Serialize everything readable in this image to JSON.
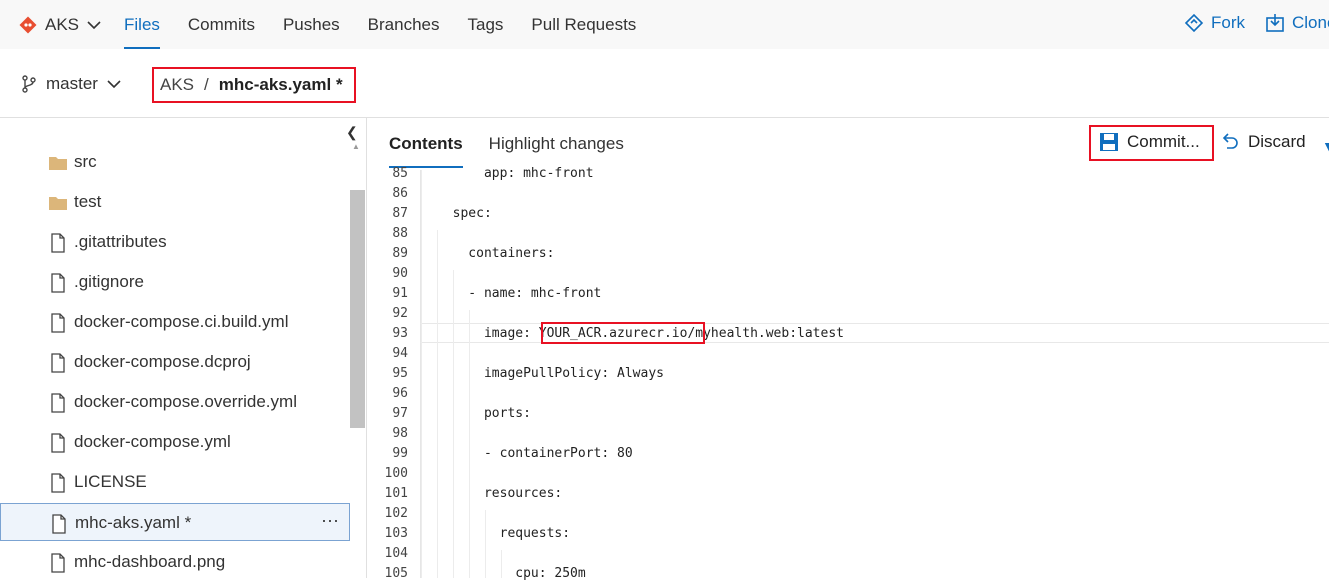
{
  "header": {
    "repo_name": "AKS",
    "tabs": [
      "Files",
      "Commits",
      "Pushes",
      "Branches",
      "Tags",
      "Pull Requests"
    ],
    "fork_label": "Fork",
    "clone_label": "Clone"
  },
  "pathbar": {
    "branch": "master",
    "repo": "AKS",
    "separator": "/",
    "file": "mhc-aks.yaml *"
  },
  "sidebar": {
    "items": [
      {
        "name": "src",
        "type": "folder"
      },
      {
        "name": "test",
        "type": "folder"
      },
      {
        "name": ".gitattributes",
        "type": "file"
      },
      {
        "name": ".gitignore",
        "type": "file"
      },
      {
        "name": "docker-compose.ci.build.yml",
        "type": "file"
      },
      {
        "name": "docker-compose.dcproj",
        "type": "file"
      },
      {
        "name": "docker-compose.override.yml",
        "type": "file"
      },
      {
        "name": "docker-compose.yml",
        "type": "file"
      },
      {
        "name": "LICENSE",
        "type": "file"
      },
      {
        "name": "mhc-aks.yaml *",
        "type": "file",
        "selected": true
      },
      {
        "name": "mhc-dashboard.png",
        "type": "file"
      }
    ],
    "more_label": "···"
  },
  "content": {
    "tabs": [
      "Contents",
      "Highlight changes"
    ],
    "commit_label": "Commit...",
    "discard_label": "Discard"
  },
  "code": {
    "lines": [
      {
        "n": "85",
        "text": "      app: mhc-front"
      },
      {
        "n": "86",
        "text": ""
      },
      {
        "n": "87",
        "text": "  spec:"
      },
      {
        "n": "88",
        "text": ""
      },
      {
        "n": "89",
        "text": "    containers:"
      },
      {
        "n": "90",
        "text": ""
      },
      {
        "n": "91",
        "text": "    - name: mhc-front"
      },
      {
        "n": "92",
        "text": ""
      },
      {
        "n": "93",
        "text": "      image: YOUR_ACR.azurecr.io/myhealth.web:latest"
      },
      {
        "n": "94",
        "text": ""
      },
      {
        "n": "95",
        "text": "      imagePullPolicy: Always"
      },
      {
        "n": "96",
        "text": ""
      },
      {
        "n": "97",
        "text": "      ports:"
      },
      {
        "n": "98",
        "text": ""
      },
      {
        "n": "99",
        "text": "      - containerPort: 80"
      },
      {
        "n": "100",
        "text": ""
      },
      {
        "n": "101",
        "text": "      resources:"
      },
      {
        "n": "102",
        "text": ""
      },
      {
        "n": "103",
        "text": "        requests:"
      },
      {
        "n": "104",
        "text": ""
      },
      {
        "n": "105",
        "text": "          cpu: 250m"
      }
    ]
  },
  "colors": {
    "accent": "#106ebe",
    "highlight_border": "#e81123",
    "folder": "#dcb67a"
  }
}
